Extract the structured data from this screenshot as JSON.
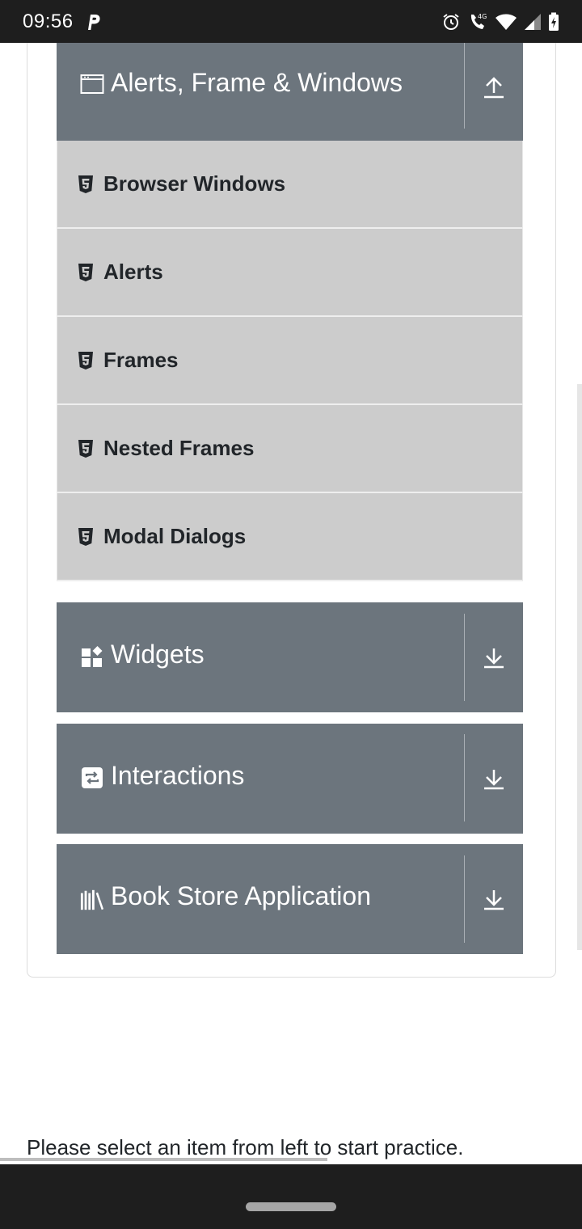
{
  "status_bar": {
    "time": "09:56",
    "network": "4G",
    "icons": [
      "parking-icon",
      "alarm-icon",
      "call-4g-icon",
      "wifi-icon",
      "signal-icon",
      "battery-charging-icon"
    ]
  },
  "groups": {
    "alerts": {
      "title": "Alerts, Frame & Windows",
      "icon": "window-icon",
      "toggle_icon": "collapse-up-icon",
      "expanded": true
    },
    "widgets": {
      "title": "Widgets",
      "icon": "widgets-icon",
      "toggle_icon": "expand-down-icon",
      "expanded": false
    },
    "interactions": {
      "title": "Interactions",
      "icon": "interactions-icon",
      "toggle_icon": "expand-down-icon",
      "expanded": false
    },
    "bookstore": {
      "title": "Book Store Application",
      "icon": "books-icon",
      "toggle_icon": "expand-down-icon",
      "expanded": false
    }
  },
  "menu_items": [
    {
      "label": "Browser Windows",
      "icon": "html5-icon"
    },
    {
      "label": "Alerts",
      "icon": "html5-icon"
    },
    {
      "label": "Frames",
      "icon": "html5-icon"
    },
    {
      "label": "Nested Frames",
      "icon": "html5-icon"
    },
    {
      "label": "Modal Dialogs",
      "icon": "html5-icon"
    }
  ],
  "footer": {
    "text": "Please select an item from left to start practice."
  },
  "colors": {
    "header_bg": "#6c757d",
    "item_bg": "#cccccc",
    "text_dark": "#212529",
    "system_bar": "#1e1e1e"
  }
}
